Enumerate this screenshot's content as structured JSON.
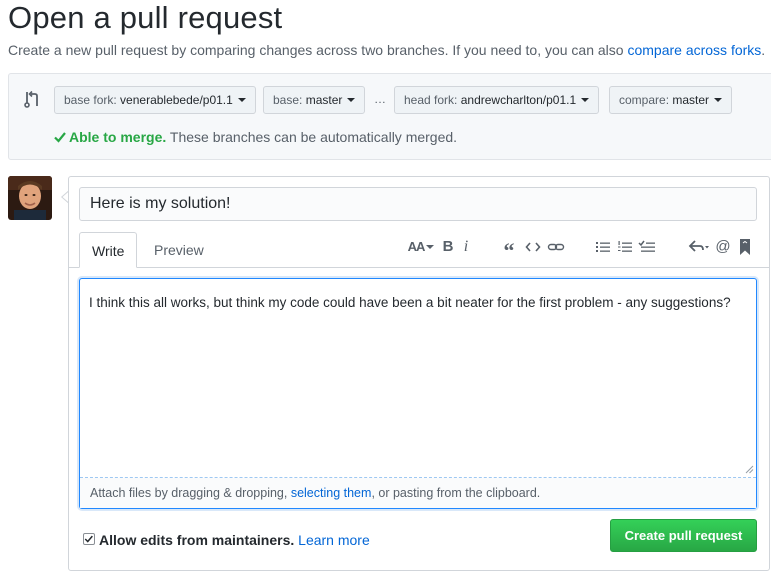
{
  "header": {
    "title": "Open a pull request",
    "subtitle": "Create a new pull request by comparing changes across two branches. If you need to, you can also",
    "subtitle_link": "compare across forks",
    "subtitle_end": "."
  },
  "range": {
    "base_fork": {
      "label": "base fork:",
      "value": "venerablebede/p01.1"
    },
    "base": {
      "label": "base:",
      "value": "master"
    },
    "separator": "…",
    "head_fork": {
      "label": "head fork:",
      "value": "andrewcharlton/p01.1"
    },
    "compare": {
      "label": "compare:",
      "value": "master"
    },
    "merge_status": "Able to merge.",
    "merge_detail": "These branches can be automatically merged."
  },
  "form": {
    "title_value": "Here is my solution!",
    "tabs": [
      {
        "label": "Write",
        "active": true
      },
      {
        "label": "Preview",
        "active": false
      }
    ],
    "toolbar": {
      "header_label": "AA",
      "bold_label": "B",
      "italic_label": "i",
      "quote_label": "“"
    },
    "body_value": "I think this all works, but think my code could have been a bit neater for the first problem - any suggestions?",
    "attach_prefix": "Attach files by dragging & dropping, ",
    "attach_link": "selecting them",
    "attach_suffix": ", or pasting from the clipboard.",
    "allow_edits_label": "Allow edits from maintainers.",
    "allow_edits_checked": true,
    "learn_more": "Learn more",
    "submit_label": "Create pull request"
  },
  "icons": {
    "compare": "git-compare-icon",
    "check": "check-icon",
    "avatar": "user-avatar"
  },
  "colors": {
    "link": "#0366d6",
    "success": "#28a745",
    "button_green": "#2cbe4e"
  }
}
